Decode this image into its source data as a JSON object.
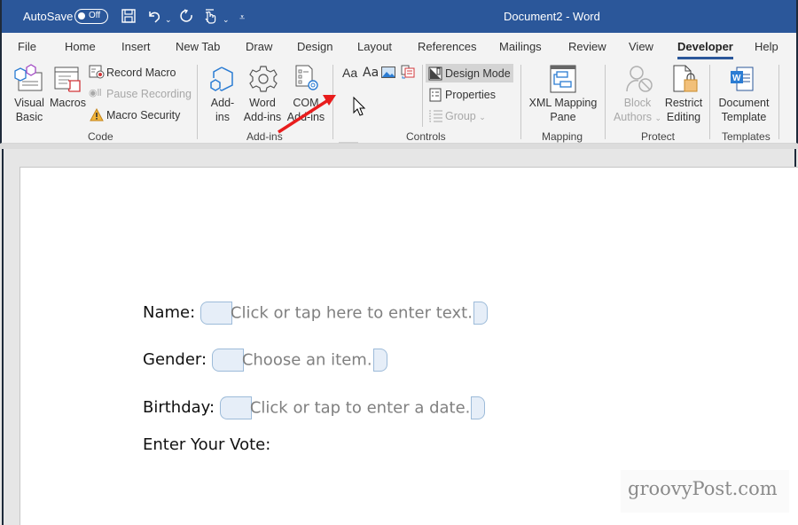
{
  "titlebar": {
    "autosave_label": "AutoSave",
    "autosave_state": "Off",
    "document_title": "Document2  -  Word",
    "brand_color": "#2b579a"
  },
  "menu": {
    "tabs": [
      {
        "label": "File"
      },
      {
        "label": "Home"
      },
      {
        "label": "Insert"
      },
      {
        "label": "New Tab"
      },
      {
        "label": "Draw"
      },
      {
        "label": "Design"
      },
      {
        "label": "Layout"
      },
      {
        "label": "References"
      },
      {
        "label": "Mailings"
      },
      {
        "label": "Review"
      },
      {
        "label": "View"
      },
      {
        "label": "Developer",
        "active": true
      },
      {
        "label": "Help"
      }
    ]
  },
  "ribbon": {
    "code": {
      "group_label": "Code",
      "visual_basic": "Visual\nBasic",
      "visual_basic_l1": "Visual",
      "visual_basic_l2": "Basic",
      "macros": "Macros",
      "record_macro": "Record Macro",
      "pause_recording": "Pause Recording",
      "macro_security": "Macro Security"
    },
    "addins": {
      "group_label": "Add-ins",
      "addins_l1": "Add-",
      "addins_l2": "ins",
      "word_addins_l1": "Word",
      "word_addins_l2": "Add-ins",
      "com_addins_l1": "COM",
      "com_addins_l2": "Add-ins"
    },
    "controls": {
      "group_label": "Controls",
      "design_mode": "Design Mode",
      "properties": "Properties",
      "group": "Group",
      "rich_text_glyph": "Aa",
      "plain_text_glyph": "Aa"
    },
    "mapping": {
      "group_label": "Mapping",
      "xml_l1": "XML Mapping",
      "xml_l2": "Pane"
    },
    "protect": {
      "group_label": "Protect",
      "block_l1": "Block",
      "block_l2": "Authors",
      "restrict_l1": "Restrict",
      "restrict_l2": "Editing"
    },
    "templates": {
      "group_label": "Templates",
      "doc_l1": "Document",
      "doc_l2": "Template"
    }
  },
  "document": {
    "fields": [
      {
        "label": "Name:",
        "placeholder": "Click or tap here to enter text."
      },
      {
        "label": "Gender:",
        "placeholder": "Choose an item."
      },
      {
        "label": "Birthday:",
        "placeholder": "Click or tap to enter a date."
      }
    ],
    "vote_label": "Enter Your Vote:"
  },
  "watermark": "groovyPost.com"
}
